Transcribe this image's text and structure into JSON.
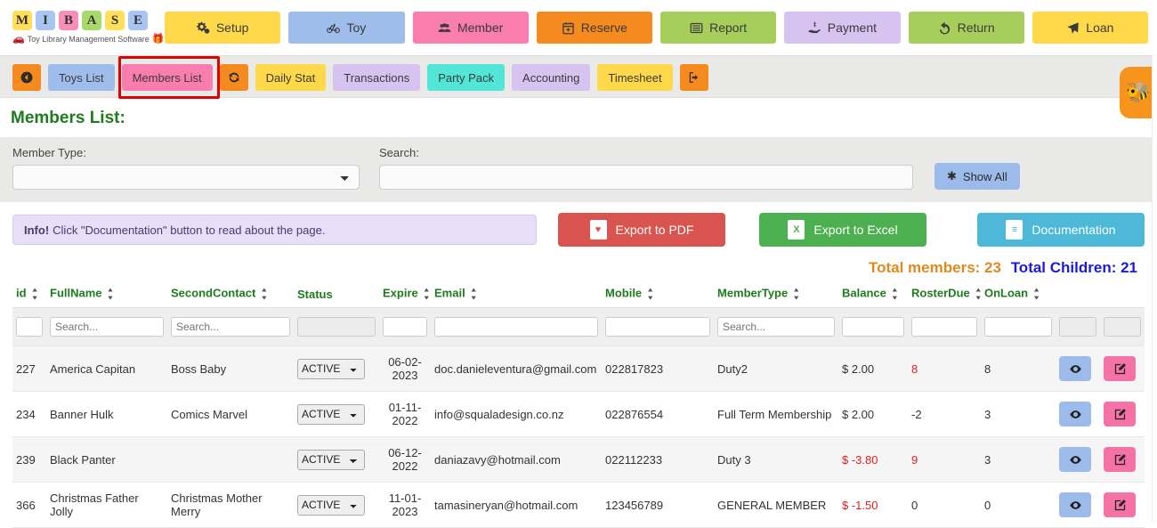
{
  "app": {
    "logo_letters": [
      {
        "ch": "M",
        "color": "#ffdf5c"
      },
      {
        "ch": "I",
        "color": "#a8c6ef"
      },
      {
        "ch": "B",
        "color": "#f78fb8"
      },
      {
        "ch": "A",
        "color": "#a8d96b"
      },
      {
        "ch": "S",
        "color": "#ffdf5c"
      },
      {
        "ch": "E",
        "color": "#a8c6ef"
      }
    ],
    "tagline": "Toy Library Management Software"
  },
  "topnav": [
    {
      "label": "Setup",
      "icon": "gears-icon",
      "color": "#ffd94a"
    },
    {
      "label": "Toy",
      "icon": "bicycle-icon",
      "color": "#9fbdea"
    },
    {
      "label": "Member",
      "icon": "users-icon",
      "color": "#f97dae"
    },
    {
      "label": "Reserve",
      "icon": "calendar-icon",
      "color": "#f58a1e"
    },
    {
      "label": "Report",
      "icon": "list-icon",
      "color": "#a6ce5a"
    },
    {
      "label": "Payment",
      "icon": "hand-cash-icon",
      "color": "#d7c3f0"
    },
    {
      "label": "Return",
      "icon": "undo-icon",
      "color": "#a6ce5a"
    },
    {
      "label": "Loan",
      "icon": "paper-plane-icon",
      "color": "#ffd94a"
    }
  ],
  "subnav": [
    {
      "label": "",
      "icon": "back-arrow-icon",
      "color": "#f58a1e",
      "type": "icon"
    },
    {
      "label": "Toys List",
      "color": "#9fbdea"
    },
    {
      "label": "Members List",
      "color": "#f97dae",
      "highlighted": true
    },
    {
      "label": "",
      "icon": "refresh-icon",
      "color": "#f58a1e",
      "type": "icon"
    },
    {
      "label": "Daily Stat",
      "color": "#ffd94a"
    },
    {
      "label": "Transactions",
      "color": "#d7c3f0"
    },
    {
      "label": "Party Pack",
      "color": "#52e6d8"
    },
    {
      "label": "Accounting",
      "color": "#d7c3f0"
    },
    {
      "label": "Timesheet",
      "color": "#ffd94a"
    },
    {
      "label": "",
      "icon": "logout-icon",
      "color": "#f58a1e",
      "type": "icon"
    }
  ],
  "mascot": {
    "icon": "bee-mascot-icon",
    "glyph": "🐝",
    "color": "#f7941e"
  },
  "page_title": "Members List:",
  "filters": {
    "member_type_label": "Member Type:",
    "member_type_value": "",
    "search_label": "Search:",
    "search_value": "",
    "search_placeholder": "",
    "show_all_label": "Show All",
    "show_all_icon": "asterisk-icon"
  },
  "info_bar": {
    "prefix": "Info!",
    "text": "Click \"Documentation\" button to read about the page."
  },
  "actions": [
    {
      "label": "Export to PDF",
      "icon": "pdf-file-icon",
      "color": "#d9534f",
      "badge": "♥"
    },
    {
      "label": "Export to Excel",
      "icon": "excel-file-icon",
      "color": "#4caf50",
      "badge": "X"
    },
    {
      "label": "Documentation",
      "icon": "doc-file-icon",
      "color": "#4db8d8",
      "badge": "≡"
    }
  ],
  "totals": {
    "members_label": "Total members: 23",
    "children_label": "Total Children: 21"
  },
  "table": {
    "columns": [
      {
        "key": "id",
        "label": "id",
        "sortable": true,
        "filter": "none",
        "filter_placeholder": ""
      },
      {
        "key": "fullname",
        "label": "FullName",
        "sortable": true,
        "filter": "text",
        "filter_placeholder": "Search..."
      },
      {
        "key": "secondcontact",
        "label": "SecondContact",
        "sortable": true,
        "filter": "text",
        "filter_placeholder": "Search..."
      },
      {
        "key": "status",
        "label": "Status",
        "sortable": false,
        "filter": "disabled",
        "filter_placeholder": ""
      },
      {
        "key": "expire",
        "label": "Expire",
        "sortable": true,
        "filter": "text",
        "filter_placeholder": ""
      },
      {
        "key": "email",
        "label": "Email",
        "sortable": true,
        "filter": "text",
        "filter_placeholder": ""
      },
      {
        "key": "mobile",
        "label": "Mobile",
        "sortable": true,
        "filter": "text",
        "filter_placeholder": ""
      },
      {
        "key": "membertype",
        "label": "MemberType",
        "sortable": true,
        "filter": "text",
        "filter_placeholder": "Search..."
      },
      {
        "key": "balance",
        "label": "Balance",
        "sortable": true,
        "filter": "text",
        "filter_placeholder": ""
      },
      {
        "key": "rosterdue",
        "label": "RosterDue",
        "sortable": true,
        "filter": "text",
        "filter_placeholder": ""
      },
      {
        "key": "onloan",
        "label": "OnLoan",
        "sortable": true,
        "filter": "text",
        "filter_placeholder": ""
      },
      {
        "key": "view",
        "label": "",
        "sortable": false,
        "filter": "disabled",
        "filter_placeholder": ""
      },
      {
        "key": "edit",
        "label": "",
        "sortable": false,
        "filter": "disabled",
        "filter_placeholder": ""
      }
    ],
    "status_options": [
      "ACTIVE"
    ],
    "rows": [
      {
        "id": "227",
        "fullname": "America Capitan",
        "secondcontact": "Boss Baby",
        "status": "ACTIVE",
        "expire": "06-02-\n2023",
        "email": "doc.danieleventura@gmail.com",
        "mobile": "022817823",
        "membertype": "Duty2",
        "balance": "$ 2.00",
        "balance_negative": false,
        "rosterdue": "8",
        "rosterdue_alert": true,
        "onloan": "8"
      },
      {
        "id": "234",
        "fullname": "Banner Hulk",
        "secondcontact": "Comics Marvel",
        "status": "ACTIVE",
        "expire": "01-11-\n2022",
        "email": "info@squaladesign.co.nz",
        "mobile": "022876554",
        "membertype": "Full Term Membership",
        "balance": "$ 2.00",
        "balance_negative": false,
        "rosterdue": "-2",
        "rosterdue_alert": false,
        "onloan": "3"
      },
      {
        "id": "239",
        "fullname": "Black Panter",
        "secondcontact": "",
        "status": "ACTIVE",
        "expire": "06-12-\n2022",
        "email": "daniazavy@hotmail.com",
        "mobile": "022112233",
        "membertype": "Duty 3",
        "balance": "$ -3.80",
        "balance_negative": true,
        "rosterdue": "9",
        "rosterdue_alert": true,
        "onloan": "3"
      },
      {
        "id": "366",
        "fullname": "Christmas Father Jolly",
        "secondcontact": "Christmas Mother Merry",
        "status": "ACTIVE",
        "expire": "11-01-\n2023",
        "email": "tamasineryan@hotmail.com",
        "mobile": "123456789",
        "membertype": "GENERAL MEMBER",
        "balance": "$ -1.50",
        "balance_negative": true,
        "rosterdue": "0",
        "rosterdue_alert": false,
        "onloan": "0"
      }
    ],
    "row_actions": [
      {
        "key": "view",
        "icon": "eye-icon",
        "color": "#9dbbea"
      },
      {
        "key": "edit",
        "icon": "pencil-square-icon",
        "color": "#f472a6"
      }
    ]
  }
}
